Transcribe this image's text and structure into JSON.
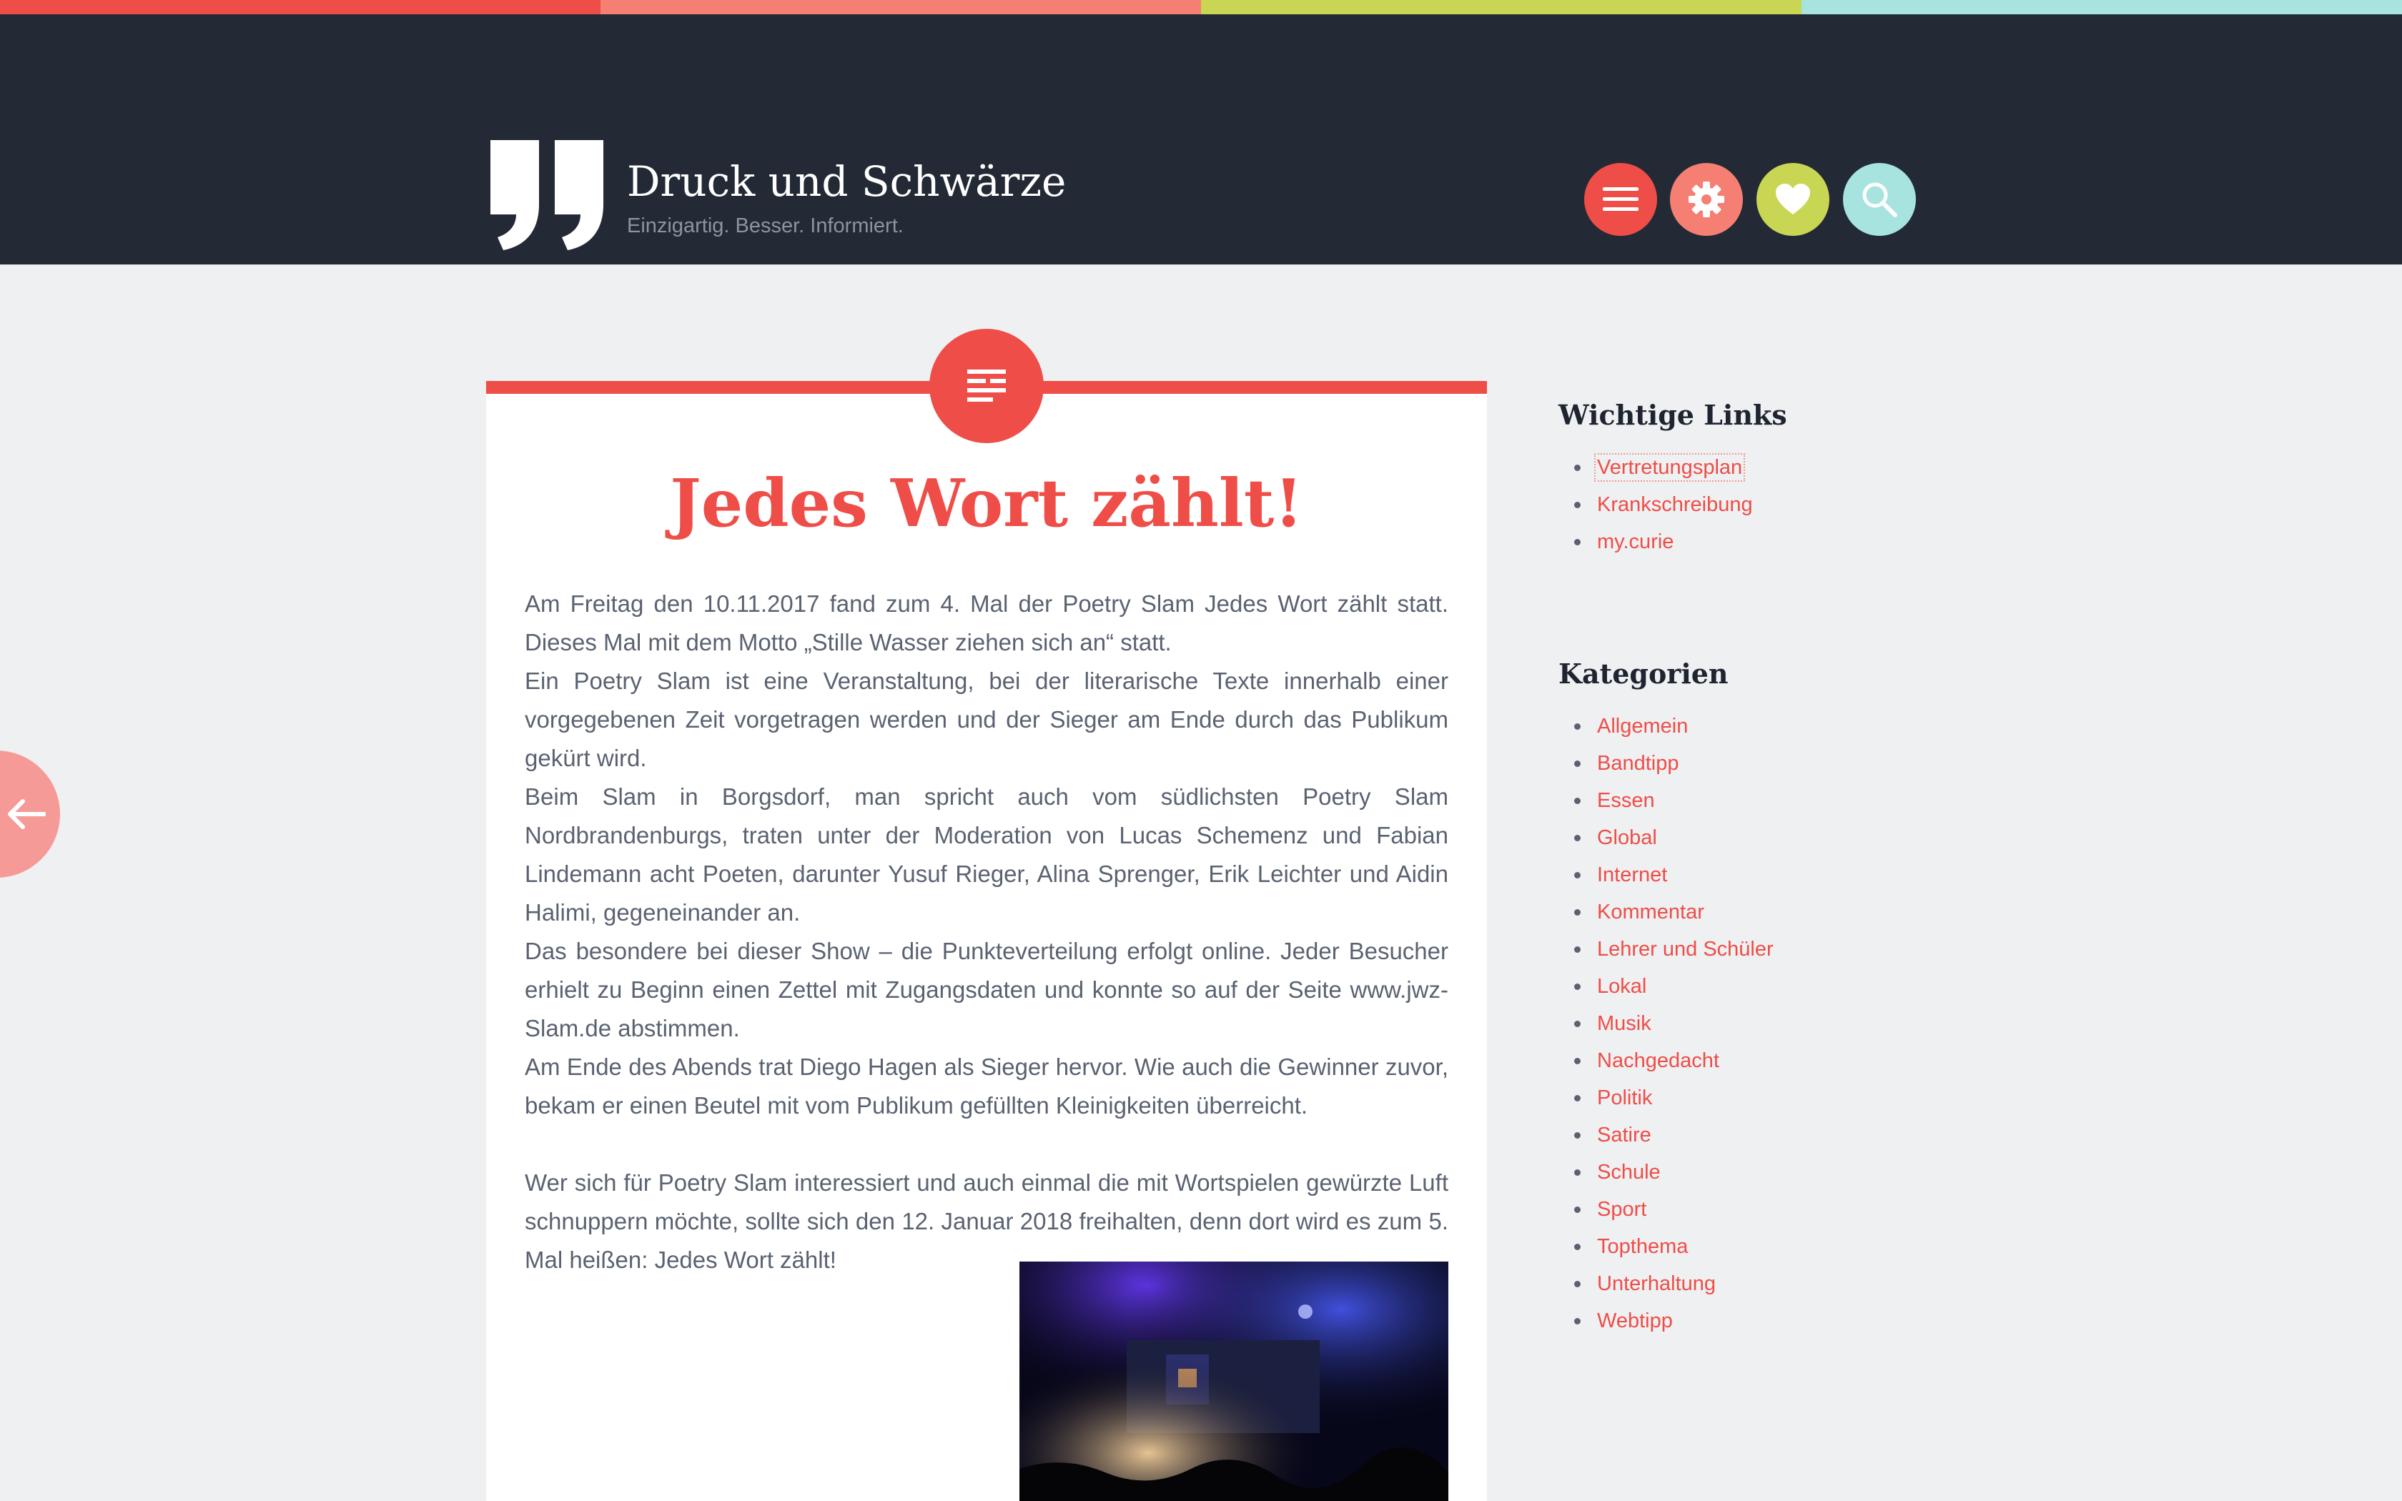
{
  "colors": {
    "red": "#ef4d47",
    "salmon": "#f47f72",
    "lime": "#c9d653",
    "aqua": "#a7e3df",
    "header_bg": "#232a35",
    "page_bg": "#eff0f2"
  },
  "header": {
    "site_title": "Druck und Schwärze",
    "tagline": "Einzigartig. Besser. Informiert.",
    "logo_icon": "quote-mark-logo",
    "buttons": [
      {
        "name": "menu-button",
        "icon": "menu-icon"
      },
      {
        "name": "settings-button",
        "icon": "gear-icon"
      },
      {
        "name": "favorites-button",
        "icon": "heart-icon"
      },
      {
        "name": "search-button",
        "icon": "search-icon"
      }
    ]
  },
  "post": {
    "format_icon": "text-lines-icon",
    "title": "Jedes Wort zählt!",
    "paragraphs": [
      "Am Freitag den 10.11.2017 fand zum 4. Mal der Poetry Slam Jedes Wort zählt statt. Dieses Mal mit dem Motto „Stille Wasser ziehen sich an“ statt.",
      "Ein Poetry Slam ist eine Veranstaltung, bei der literarische Texte innerhalb einer vorgegebenen Zeit vorgetragen werden und der Sieger am Ende durch das Publikum gekürt wird.",
      "Beim Slam in Borgsdorf, man spricht auch vom südlichsten Poetry Slam Nordbrandenburgs, traten unter der Moderation von Lucas Schemenz und Fabian Lindemann acht Poeten, darunter Yusuf Rieger, Alina Sprenger, Erik Leichter und Aidin Halimi, gegeneinander an.",
      "Das besondere bei dieser Show – die Punkteverteilung erfolgt online. Jeder Besucher erhielt zu Beginn einen Zettel mit Zugangsdaten und konnte so auf der Seite www.jwz-Slam.de abstimmen.",
      "Am Ende des Abends trat Diego Hagen als Sieger hervor. Wie auch die Gewinner zuvor, bekam er einen Beutel mit vom Publikum gefüllten Kleinigkeiten überreicht.",
      "Wer sich für Poetry Slam interessiert und auch einmal die mit Wortspielen gewürzte Luft schnuppern möchte, sollte sich den 12. Januar 2018 freihalten, denn dort wird es zum 5. Mal heißen: Jedes Wort zählt!"
    ]
  },
  "sidebar": {
    "links_title": "Wichtige Links",
    "links": [
      "Vertretungsplan",
      "Krankschreibung",
      "my.curie"
    ],
    "categories_title": "Kategorien",
    "categories": [
      "Allgemein",
      "Bandtipp",
      "Essen",
      "Global",
      "Internet",
      "Kommentar",
      "Lehrer und Schüler",
      "Lokal",
      "Musik",
      "Nachgedacht",
      "Politik",
      "Satire",
      "Schule",
      "Sport",
      "Topthema",
      "Unterhaltung",
      "Webtipp"
    ]
  },
  "nav": {
    "prev_icon": "arrow-left-icon"
  }
}
